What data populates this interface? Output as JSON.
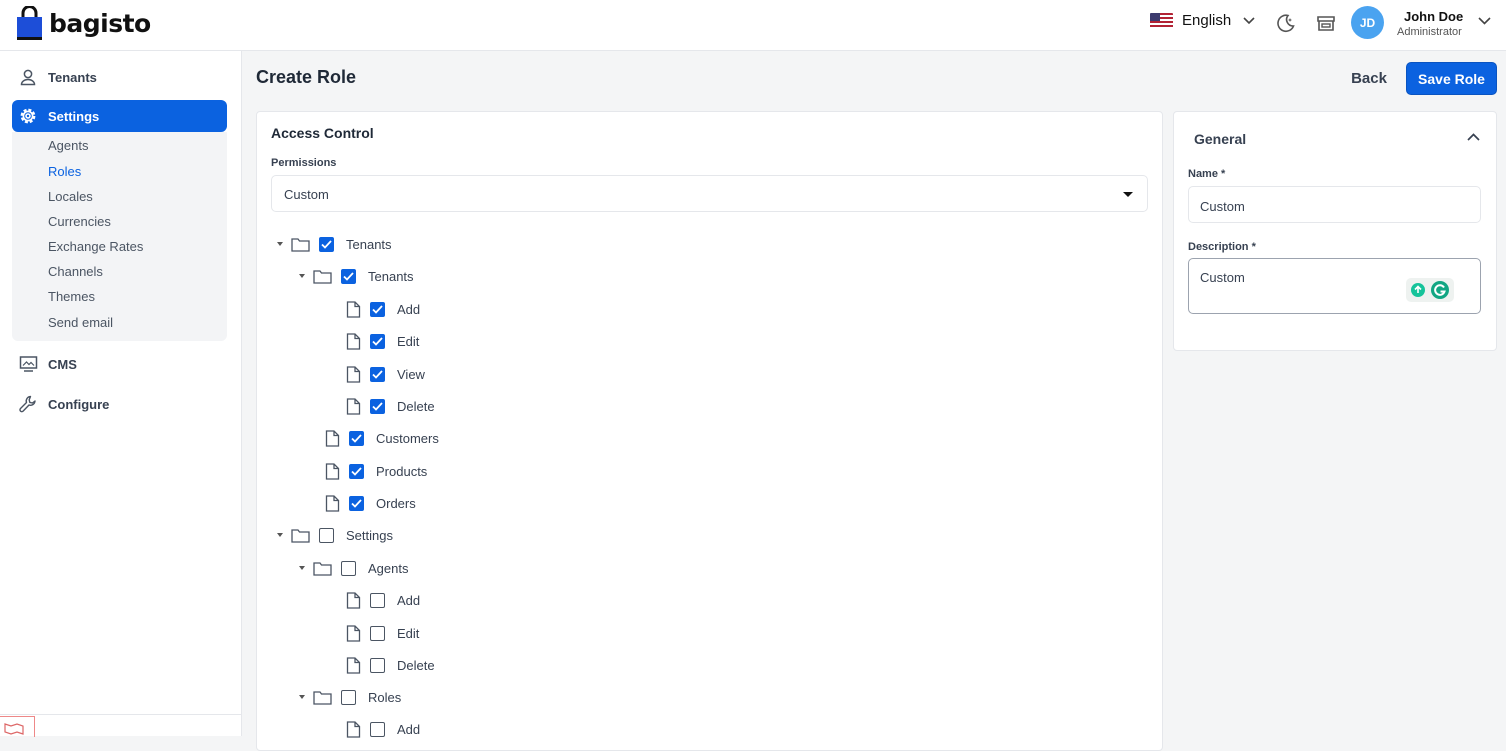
{
  "header": {
    "logo_text": "bagisto",
    "language": "English",
    "user": {
      "initials": "JD",
      "name": "John Doe",
      "role": "Administrator"
    }
  },
  "sidebar": {
    "items": [
      {
        "label": "Tenants",
        "icon": "person-icon"
      },
      {
        "label": "Settings",
        "icon": "gear-icon",
        "active": true
      },
      {
        "label": "CMS",
        "icon": "monitor-icon"
      },
      {
        "label": "Configure",
        "icon": "wrench-icon"
      }
    ],
    "settings_submenu": [
      "Agents",
      "Roles",
      "Locales",
      "Currencies",
      "Exchange Rates",
      "Channels",
      "Themes",
      "Send email"
    ],
    "selected_submenu": "Roles"
  },
  "page": {
    "title": "Create Role",
    "back_label": "Back",
    "save_label": "Save Role"
  },
  "access_control": {
    "title": "Access Control",
    "permissions_label": "Permissions",
    "permissions_value": "Custom",
    "tree": [
      {
        "label": "Tenants",
        "checked": true
      },
      {
        "label": "Tenants",
        "checked": true
      },
      {
        "label": "Add",
        "checked": true
      },
      {
        "label": "Edit",
        "checked": true
      },
      {
        "label": "View",
        "checked": true
      },
      {
        "label": "Delete",
        "checked": true
      },
      {
        "label": "Customers",
        "checked": true
      },
      {
        "label": "Products",
        "checked": true
      },
      {
        "label": "Orders",
        "checked": true
      },
      {
        "label": "Settings",
        "checked": false
      },
      {
        "label": "Agents",
        "checked": false
      },
      {
        "label": "Add",
        "checked": false
      },
      {
        "label": "Edit",
        "checked": false
      },
      {
        "label": "Delete",
        "checked": false
      },
      {
        "label": "Roles",
        "checked": false
      },
      {
        "label": "Add",
        "checked": false
      }
    ]
  },
  "general": {
    "title": "General",
    "name_label": "Name *",
    "name_value": "Custom",
    "description_label": "Description *",
    "description_value": "Custom"
  },
  "colors": {
    "primary": "#0b62e0",
    "avatar": "#4aa3f0"
  }
}
